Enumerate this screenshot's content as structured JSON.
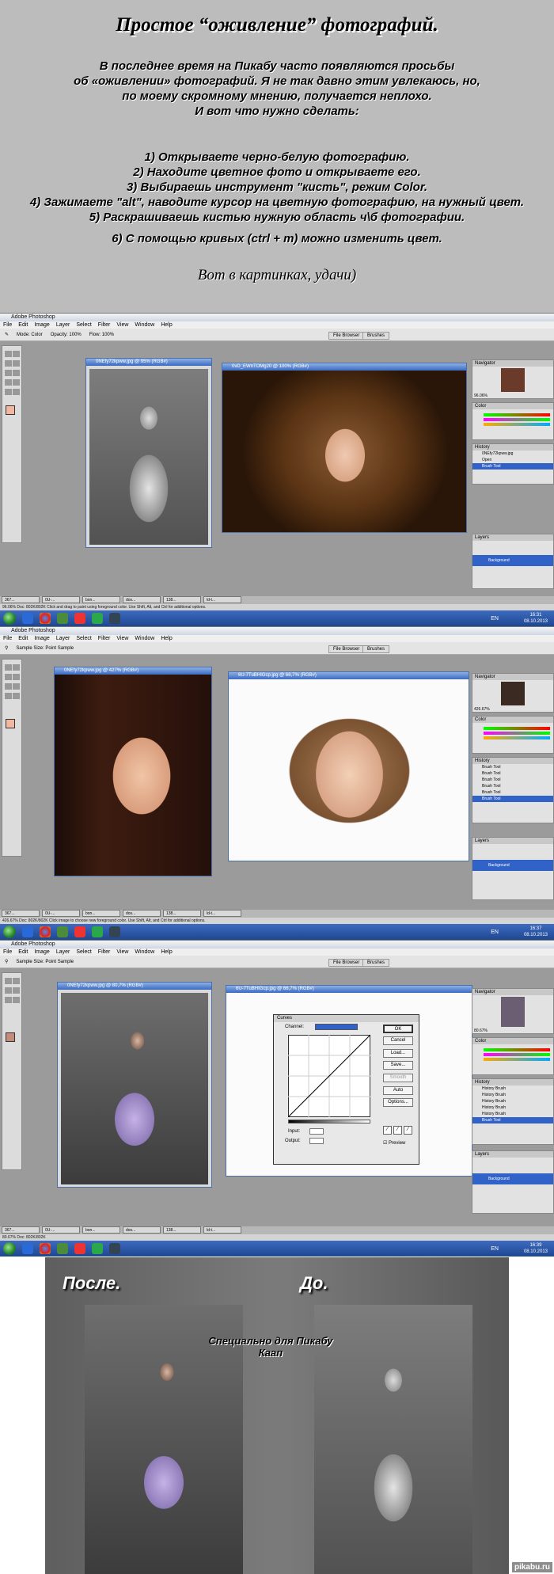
{
  "intro": {
    "title": "Простое “оживление” фотографий.",
    "paragraph": [
      "В последнее время на Пикабу часто появляются просьбы",
      "об «оживлении» фотографий. Я не так давно этим увлекаюсь, но,",
      "по моему скромному мнению, получается неплохо.",
      "И вот что нужно сделать:"
    ],
    "steps": [
      "1) Открываете черно-белую фотографию.",
      "2) Находите цветное фото и открываете его.",
      "3) Выбираешь инструмент \"кисть\", режим Color.",
      "4) Зажимаете \"alt\", наводите курсор на цветную фотографию, на нужный цвет.",
      "5) Раскрашиваешь кистью нужную область ч\\б фотографии.",
      "6) С помощью кривых (ctrl + m) можно изменить цвет."
    ],
    "luck": "Вот в картинках, удачи)"
  },
  "ps": {
    "app_title": "Adobe Photoshop",
    "menu": [
      "File",
      "Edit",
      "Image",
      "Layer",
      "Select",
      "Filter",
      "View",
      "Window",
      "Help"
    ],
    "file_browser": "File Browser",
    "brushes": "Brushes",
    "s1": {
      "mode": "Mode: Color",
      "opacity": "Opacity: 100%",
      "flow": "Flow: 100%",
      "doc1": "0NEfy72kpww.jpg @ 95% (RGB#)",
      "doc2": "0vD_EWnTOMg20 @ 100% (RGB#)",
      "zoom": "96.06%",
      "status": "96.06%   Doc: 802K/802K        Click and drag to paint using foreground color.  Use Shift, Alt, and Ctrl for additional options.",
      "history": [
        "0NEfy72kpww.jpg",
        "Open",
        "Brush Tool"
      ],
      "clock": "16:31",
      "date": "08.10.2013"
    },
    "s2": {
      "sample": "Sample Size: Point Sample",
      "doc1": "0NEfy72kpww.jpg @ 427% (RGB#)",
      "doc2": "6U-7TuBHIGcp.jpg @ 66,7% (RGB#)",
      "zoom": "426.67%",
      "status": "426.67%   Doc: 802K/802K        Click image to choose new foreground color.  Use Shift, Alt, and Ctrl for additional options.",
      "history": [
        "Brush Tool",
        "Brush Tool",
        "Brush Tool",
        "Brush Tool",
        "Brush Tool",
        "Brush Tool"
      ],
      "clock": "16:37",
      "date": "08.10.2013"
    },
    "s3": {
      "sample": "Sample Size: Point Sample",
      "doc1": "0NEfy72kpww.jpg @ 80,7% (RGB#)",
      "doc2": "6U-7TuBHIGcp.jpg @ 66,7% (RGB#)",
      "zoom": "80.67%",
      "status": "80.67%   Doc: 802K/802K",
      "history": [
        "History Brush",
        "History Brush",
        "History Brush",
        "History Brush",
        "History Brush",
        "Brush Tool"
      ],
      "clock": "16:39",
      "date": "08.10.2013",
      "curves": {
        "title": "Curves",
        "channel": "Channel:",
        "buttons": [
          "OK",
          "Cancel",
          "Load...",
          "Save...",
          "Smooth",
          "Auto",
          "Options..."
        ],
        "input": "Input:",
        "output": "Output:",
        "preview": "Preview"
      }
    },
    "minis": [
      "367...",
      "0U-...",
      "bon...",
      "dos...",
      "138...",
      "ld-t..."
    ],
    "layer": "Background",
    "lang": "EN"
  },
  "final": {
    "after": "После.",
    "before": "До.",
    "special_1": "Специально для Пикабу",
    "special_2": "Каап",
    "site": "pikabu.ru"
  }
}
